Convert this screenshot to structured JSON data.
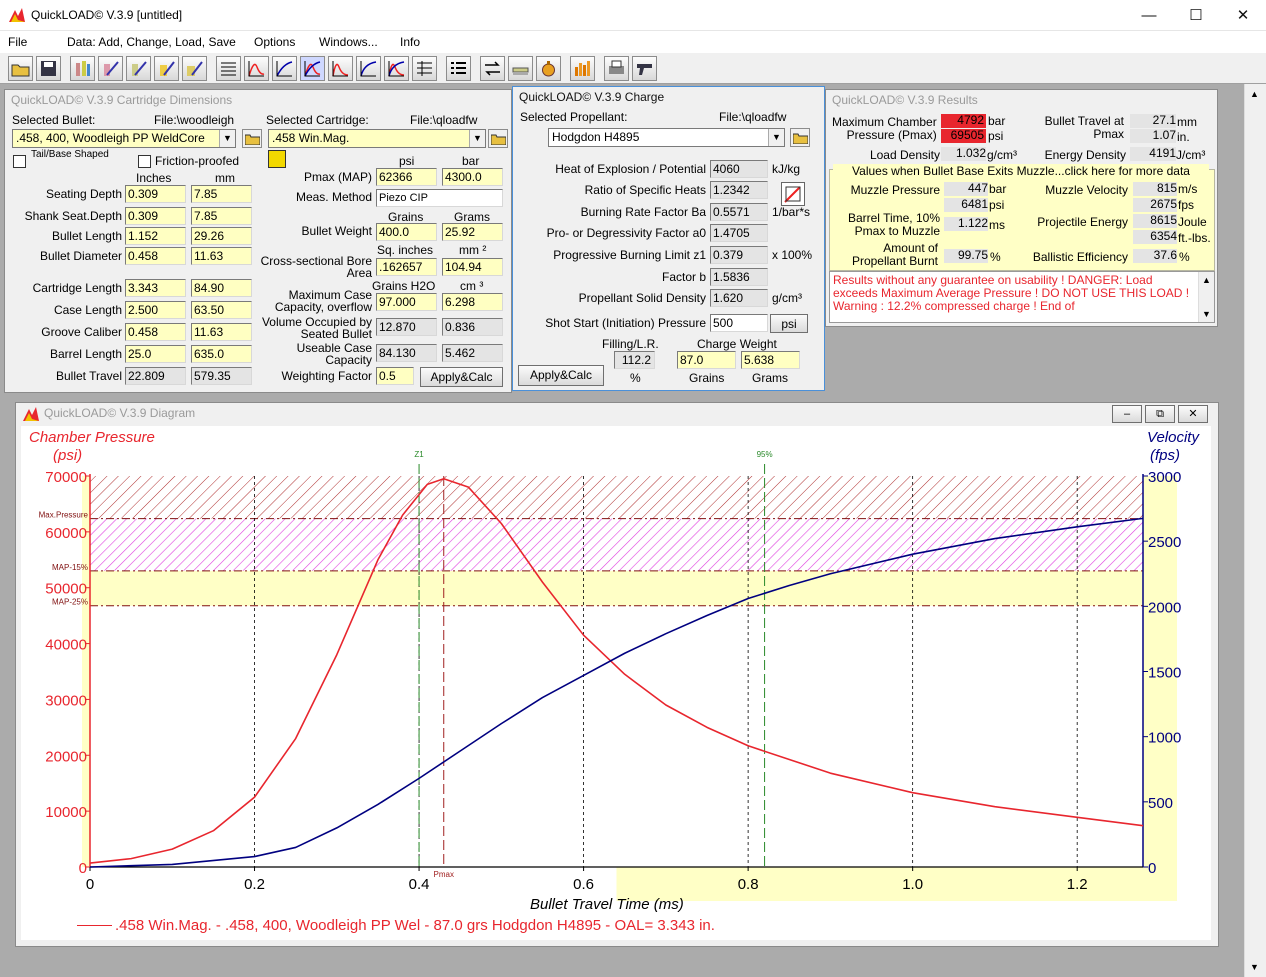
{
  "app": {
    "title": "QuickLOAD© V.3.9   [untitled]"
  },
  "menu": [
    "File",
    "Data: Add, Change, Load, Save",
    "Options",
    "Windows...",
    "Info"
  ],
  "colors": {
    "pressure_red": "#e8262e",
    "velocity_blue": "#000080",
    "warn_band": "#ffffc6"
  },
  "cart": {
    "title": "QuickLOAD© V.3.9 Cartridge Dimensions",
    "sel_bullet": "Selected Bullet:",
    "bullet_file": "File:\\woodleigh",
    "sel_cart": "Selected Cartridge:",
    "cart_file": "File:\\qloadfw",
    "bullet": ".458, 400, Woodleigh PP WeldCore",
    "cartridge": ".458 Win.Mag.",
    "tail": "Tail/Base Shaped",
    "friction": "Friction-proofed",
    "inches": "Inches",
    "mm": "mm",
    "psi": "psi",
    "bar": "bar",
    "grains": "Grains",
    "grams": "Grams",
    "sqin": "Sq. inches",
    "mm2": "mm ²",
    "grainsh2o": "Grains H2O",
    "cm3": "cm ³",
    "rows": [
      {
        "label": "Seating Depth",
        "in": "0.309",
        "mm": "7.85"
      },
      {
        "label": "Shank Seat.Depth",
        "in": "0.309",
        "mm": "7.85"
      },
      {
        "label": "Bullet Length",
        "in": "1.152",
        "mm": "29.26"
      },
      {
        "label": "Bullet Diameter",
        "in": "0.458",
        "mm": "11.63"
      },
      {
        "label": "Cartridge Length",
        "in": "3.343",
        "mm": "84.90"
      },
      {
        "label": "Case Length",
        "in": "2.500",
        "mm": "63.50"
      },
      {
        "label": "Groove Caliber",
        "in": "0.458",
        "mm": "11.63"
      },
      {
        "label": "Barrel Length",
        "in": "25.0",
        "mm": "635.0"
      },
      {
        "label": "Bullet Travel",
        "in": "22.809",
        "mm": "579.35"
      }
    ],
    "pmax_label": "Pmax (MAP)",
    "pmax_psi": "62366",
    "pmax_bar": "4300.0",
    "meas_label": "Meas. Method",
    "meas": "Piezo CIP",
    "bw_label": "Bullet Weight",
    "bw_gr": "400.0",
    "bw_g": "25.92",
    "csb_label1": "Cross-sectional Bore",
    "csb_label2": "Area",
    "csb_in": ".162657",
    "csb_mm": "104.94",
    "mcc_label1": "Maximum Case",
    "mcc_label2": "Capacity, overflow",
    "mcc_gr": "97.000",
    "mcc_cm": "6.298",
    "vol_label1": "Volume Occupied by",
    "vol_label2": "Seated Bullet",
    "vol_gr": "12.870",
    "vol_cm": "0.836",
    "ucc_label1": "Useable Case",
    "ucc_label2": "Capacity",
    "ucc_gr": "84.130",
    "ucc_cm": "5.462",
    "wf_label": "Weighting Factor",
    "wf": "0.5",
    "apply": "Apply&Calc"
  },
  "charge": {
    "title": "QuickLOAD© V.3.9 Charge",
    "sel_prop": "Selected Propellant:",
    "file": "File:\\qloadfw",
    "propellant": "Hodgdon H4895",
    "rows": [
      {
        "label": "Heat of Explosion / Potential",
        "val": "4060",
        "unit": "kJ/kg"
      },
      {
        "label": "Ratio of Specific Heats",
        "val": "1.2342",
        "unit": ""
      },
      {
        "label": "Burning Rate Factor  Ba",
        "val": "0.5571",
        "unit": "1/bar*s"
      },
      {
        "label": "Pro- or Degressivity Factor  a0",
        "val": "1.4705",
        "unit": ""
      },
      {
        "label": "Progressive Burning Limit z1",
        "val": "0.379",
        "unit": "x 100%"
      },
      {
        "label": "Factor  b",
        "val": "1.5836",
        "unit": ""
      },
      {
        "label": "Propellant Solid Density",
        "val": "1.620",
        "unit": "g/cm³"
      },
      {
        "label": "Shot Start (Initiation) Pressure",
        "val": "500",
        "unit": ""
      }
    ],
    "psi_btn": "psi",
    "apply": "Apply&Calc",
    "fill_label": "Filling/L.R.",
    "fill": "112.2",
    "pct": "%",
    "cw_label": "Charge Weight",
    "cw_gr": "87.0",
    "cw_g": "5.638",
    "grains": "Grains",
    "grams": "Grams"
  },
  "results": {
    "title": "QuickLOAD© V.3.9 Results",
    "mcp_label1": "Maximum Chamber",
    "mcp_label2": "Pressure (Pmax)",
    "mcp_bar": "4792",
    "mcp_psi": "69505",
    "bar": "bar",
    "psi": "psi",
    "bt_label1": "Bullet Travel at",
    "bt_label2": "Pmax",
    "bt_mm": "27.1",
    "bt_in": "1.07",
    "mm": "mm",
    "in": "in.",
    "ld_label": "Load Density",
    "ld": "1.032",
    "gcm3": "g/cm³",
    "ed_label": "Energy Density",
    "ed": "4191",
    "jcm3": "J/cm³",
    "muzzle_hdr": "Values when Bullet Base Exits Muzzle...click here for more data",
    "mp_label": "Muzzle Pressure",
    "mp_bar": "447",
    "mp_psi": "6481",
    "mv_label": "Muzzle Velocity",
    "mv_ms": "815",
    "mv_fps": "2675",
    "ms": "m/s",
    "fps": "fps",
    "btime_label1": "Barrel Time, 10%",
    "btime_label2": "Pmax to Muzzle",
    "btime": "1.122",
    "msu": "ms",
    "pe_label": "Projectile Energy",
    "pe_j": "8615",
    "pe_ft": "6354",
    "joule": "Joule",
    "ftlbs": "ft.-lbs.",
    "apb_label1": "Amount of",
    "apb_label2": "Propellant Burnt",
    "apb": "99.75",
    "pct": "%",
    "be_label": "Ballistic Efficiency",
    "be": "37.6",
    "warning": "Results without any guarantee on usability !  DANGER: Load exceeds Maximum Average Pressure ! DO NOT USE THIS LOAD !   Warning : 12.2% compressed charge !  End of"
  },
  "diagram": {
    "title": "QuickLOAD© V.3.9 Diagram",
    "left_title1": "Chamber Pressure",
    "left_title2": "(psi)",
    "right_title1": "Velocity",
    "right_title2": "(fps)",
    "xlabel": "Bullet Travel Time (ms)",
    "z1": "Z1",
    "p95": "95%",
    "pmax": "Pmax",
    "maxp": "Max.Pressure",
    "map15": "MAP-15%",
    "map25": "MAP-25%",
    "legend": ".458 Win.Mag. - .458, 400, Woodleigh PP Wel - 87.0 grs Hodgdon H4895 - OAL= 3.343 in."
  },
  "chart_data": {
    "type": "line",
    "xlabel": "Bullet Travel Time (ms)",
    "ylabel": "Chamber Pressure (psi)",
    "y2label": "Velocity (fps)",
    "xlim": [
      0,
      1.28
    ],
    "ylim": [
      0,
      70000
    ],
    "y2lim": [
      0,
      3000
    ],
    "x_ticks": [
      "0",
      "0.2",
      "0.4",
      "0.6",
      "0.8",
      "1.0",
      "1.2"
    ],
    "y_ticks": [
      "0",
      "10000",
      "20000",
      "30000",
      "40000",
      "50000",
      "60000",
      "70000"
    ],
    "y2_ticks": [
      "0",
      "500",
      "1000",
      "1500",
      "2000",
      "2500",
      "3000"
    ],
    "markers": {
      "z1": 0.4,
      "pmax": 0.43,
      "p95": 0.82
    },
    "levels": {
      "max_pressure": 62366,
      "map_15": 53011,
      "map_25": 46775
    },
    "series": [
      {
        "name": ".458 Win.Mag. - .458, 400, Woodleigh PP Wel - 87.0 grs Hodgdon H4895 - OAL= 3.343 in.",
        "axis": "left",
        "x": [
          0,
          0.05,
          0.1,
          0.15,
          0.2,
          0.25,
          0.3,
          0.35,
          0.38,
          0.41,
          0.43,
          0.46,
          0.5,
          0.55,
          0.6,
          0.65,
          0.7,
          0.75,
          0.8,
          0.9,
          1.0,
          1.1,
          1.2,
          1.28
        ],
        "y": [
          700,
          1500,
          3200,
          6500,
          12500,
          23000,
          38000,
          55000,
          63000,
          68500,
          69505,
          68000,
          61500,
          51000,
          41500,
          34500,
          29000,
          25000,
          21700,
          16800,
          13300,
          10800,
          8900,
          7400
        ]
      },
      {
        "name": "Velocity",
        "axis": "right",
        "x": [
          0,
          0.1,
          0.2,
          0.25,
          0.3,
          0.35,
          0.4,
          0.45,
          0.5,
          0.55,
          0.6,
          0.65,
          0.7,
          0.75,
          0.8,
          0.85,
          0.9,
          1.0,
          1.1,
          1.2,
          1.28
        ],
        "y": [
          0,
          20,
          80,
          150,
          300,
          480,
          680,
          890,
          1100,
          1300,
          1470,
          1640,
          1790,
          1930,
          2060,
          2160,
          2250,
          2400,
          2520,
          2610,
          2675
        ]
      }
    ]
  }
}
